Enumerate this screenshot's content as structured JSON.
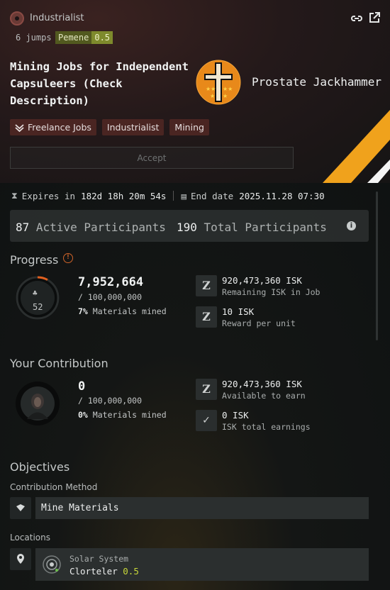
{
  "header": {
    "corporation": "Industrialist",
    "jumps": "6 jumps",
    "system_name": "Pemene",
    "system_security": "0.5",
    "link_icon": "link-icon",
    "external_icon": "external-link-icon"
  },
  "job": {
    "title": "Mining Jobs for Independent Capsuleers (Check Description)",
    "issuer": "Prostate Jackhammer",
    "tags": [
      "Freelance Jobs",
      "Industrialist",
      "Mining"
    ],
    "accept_label": "Accept"
  },
  "timing": {
    "expires_label": "Expires in",
    "expires_value": "182d 18h 20m 54s",
    "end_label": "End date",
    "end_value": "2025.11.28 07:30"
  },
  "participants": {
    "active_count": "87",
    "active_label": "Active Participants",
    "total_count": "190",
    "total_label": "Total Participants"
  },
  "progress": {
    "title": "Progress",
    "participant_count": "52",
    "progress_fraction": 0.0795,
    "amount": "7,952,664",
    "target": "/ 100,000,000",
    "percent": "7%",
    "percent_label": "Materials mined",
    "remaining_value": "920,473,360 ISK",
    "remaining_label": "Remaining ISK in Job",
    "reward_value": "10 ISK",
    "reward_label": "Reward per unit"
  },
  "contribution": {
    "title": "Your Contribution",
    "amount": "0",
    "target": "/ 100,000,000",
    "percent": "0%",
    "percent_label": "Materials mined",
    "available_value": "920,473,360 ISK",
    "available_label": "Available to earn",
    "earned_value": "0 ISK",
    "earned_label": "ISK total earnings"
  },
  "objectives": {
    "title": "Objectives",
    "method_heading": "Contribution Method",
    "method_value": "Mine Materials",
    "locations_heading": "Locations",
    "location_type": "Solar System",
    "location_name": "Clorteler",
    "location_security": "0.5"
  },
  "colors": {
    "accent_orange": "#e8891a",
    "security_green": "#c8d83a",
    "tag_bg": "#4a2522"
  }
}
